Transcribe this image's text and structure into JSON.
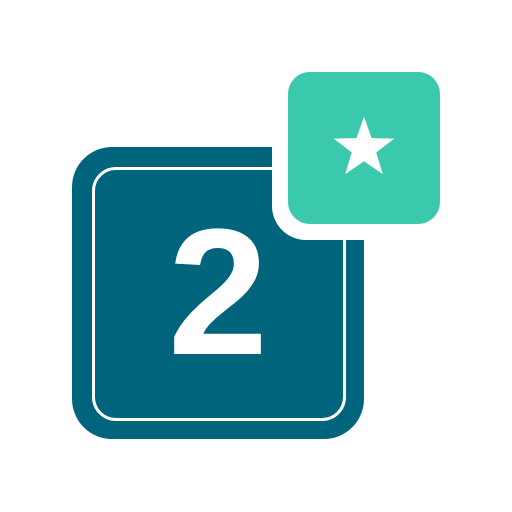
{
  "tile": {
    "number": "2",
    "color": "#00657c",
    "text_color": "#ffffff"
  },
  "badge": {
    "icon": "star-icon",
    "color": "#3ac9ac",
    "icon_color": "#ffffff"
  }
}
